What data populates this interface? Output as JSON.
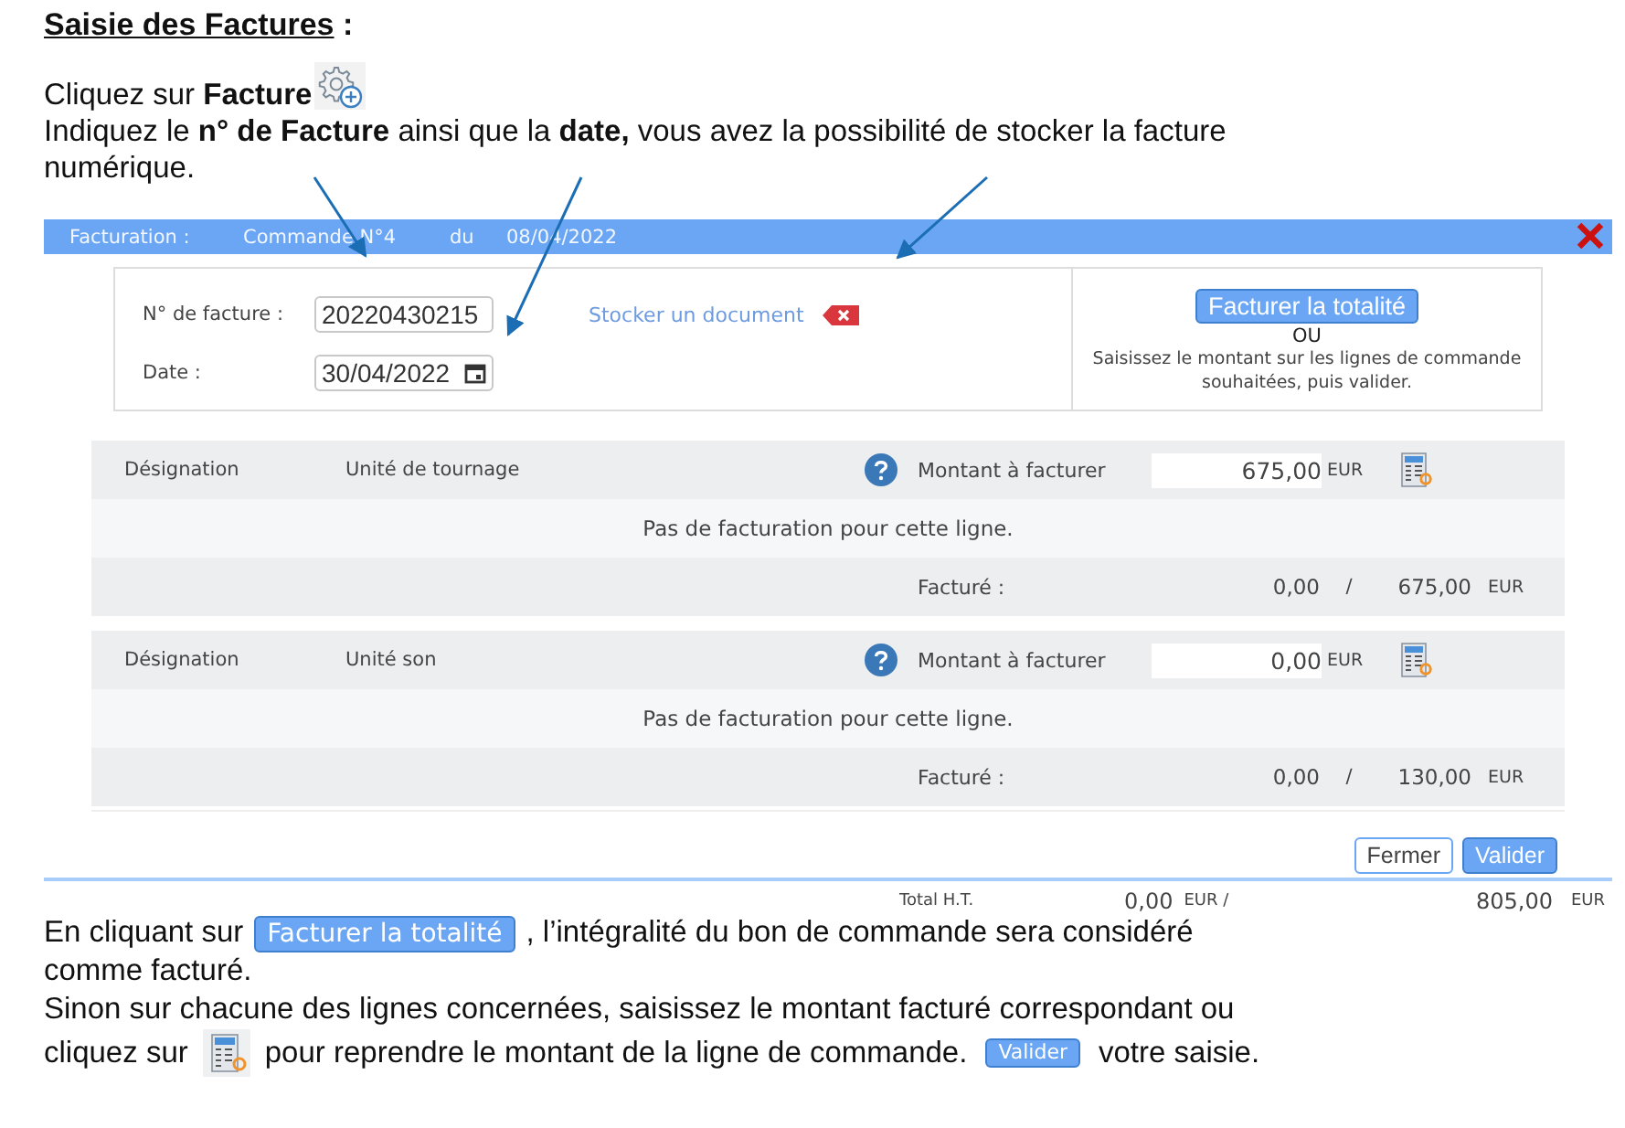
{
  "heading": {
    "title": "Saisie des Factures",
    "suffix": " :"
  },
  "intro": [
    [
      {
        "kind": "text",
        "text": "Cliquez sur **Facture**"
      },
      {
        "kind": "icon"
      }
    ],
    [
      {
        "kind": "text",
        "text": "Indiquez le **n° de Facture** ainsi que la **date,** vous avez la possibilité de stocker la facture"
      }
    ],
    [
      {
        "kind": "text",
        "text": "numérique."
      }
    ]
  ],
  "dialog": {
    "title_bar": {
      "label": "Facturation :",
      "order": "Commande N°4",
      "du": "du",
      "date": "08/04/2022"
    },
    "form": {
      "invoice_label": "N° de facture :",
      "invoice_value": "20220430215",
      "date_label": "Date :",
      "date_value": "30/04/2022",
      "store_link": "Stocker un document"
    },
    "bill_all": {
      "button": "Facturer la totalité",
      "or": "OU",
      "hint": "Saisissez le montant sur les lignes de commande souhaitées, puis valider."
    },
    "lines": [
      {
        "designation_label": "Désignation",
        "designation": "Unité de tournage",
        "amount_label": "Montant à facturer",
        "amount": "675,00",
        "currency": "EUR",
        "message": "Pas de facturation pour cette ligne.",
        "billed_label": "Facturé :",
        "billed": "0,00",
        "slash": "/",
        "total": "675,00",
        "total_currency": "EUR"
      },
      {
        "designation_label": "Désignation",
        "designation": "Unité son",
        "amount_label": "Montant à facturer",
        "amount": "0,00",
        "currency": "EUR",
        "message": "Pas de facturation pour cette ligne.",
        "billed_label": "Facturé :",
        "billed": "0,00",
        "slash": "/",
        "total": "130,00",
        "total_currency": "EUR"
      }
    ],
    "buttons": [
      {
        "label": "Fermer",
        "kind": "secondary"
      },
      {
        "label": "Valider",
        "kind": "primary"
      }
    ],
    "totals": {
      "label": "Total H.T.",
      "billed": "0,00",
      "billed_currency": "EUR /",
      "total": "805,00",
      "total_currency": "EUR"
    }
  },
  "outro": [
    [
      {
        "kind": "text",
        "text": "En cliquant sur"
      },
      {
        "kind": "button",
        "text": "Facturer la totalité"
      },
      {
        "kind": "text",
        "text": ", l’intégralité du bon de commande sera considéré"
      }
    ],
    [
      {
        "kind": "text",
        "text": "comme facturé."
      }
    ],
    [
      {
        "kind": "text",
        "text": "Sinon sur chacune des lignes concernées, saisissez le montant facturé correspondant ou"
      }
    ],
    [
      {
        "kind": "text",
        "text": "cliquez sur"
      },
      {
        "kind": "icon"
      },
      {
        "kind": "text",
        "text": "pour reprendre le montant de la ligne de commande."
      },
      {
        "kind": "small_button",
        "text": "Valider"
      },
      {
        "kind": "text",
        "text": "votre saisie."
      }
    ]
  ]
}
